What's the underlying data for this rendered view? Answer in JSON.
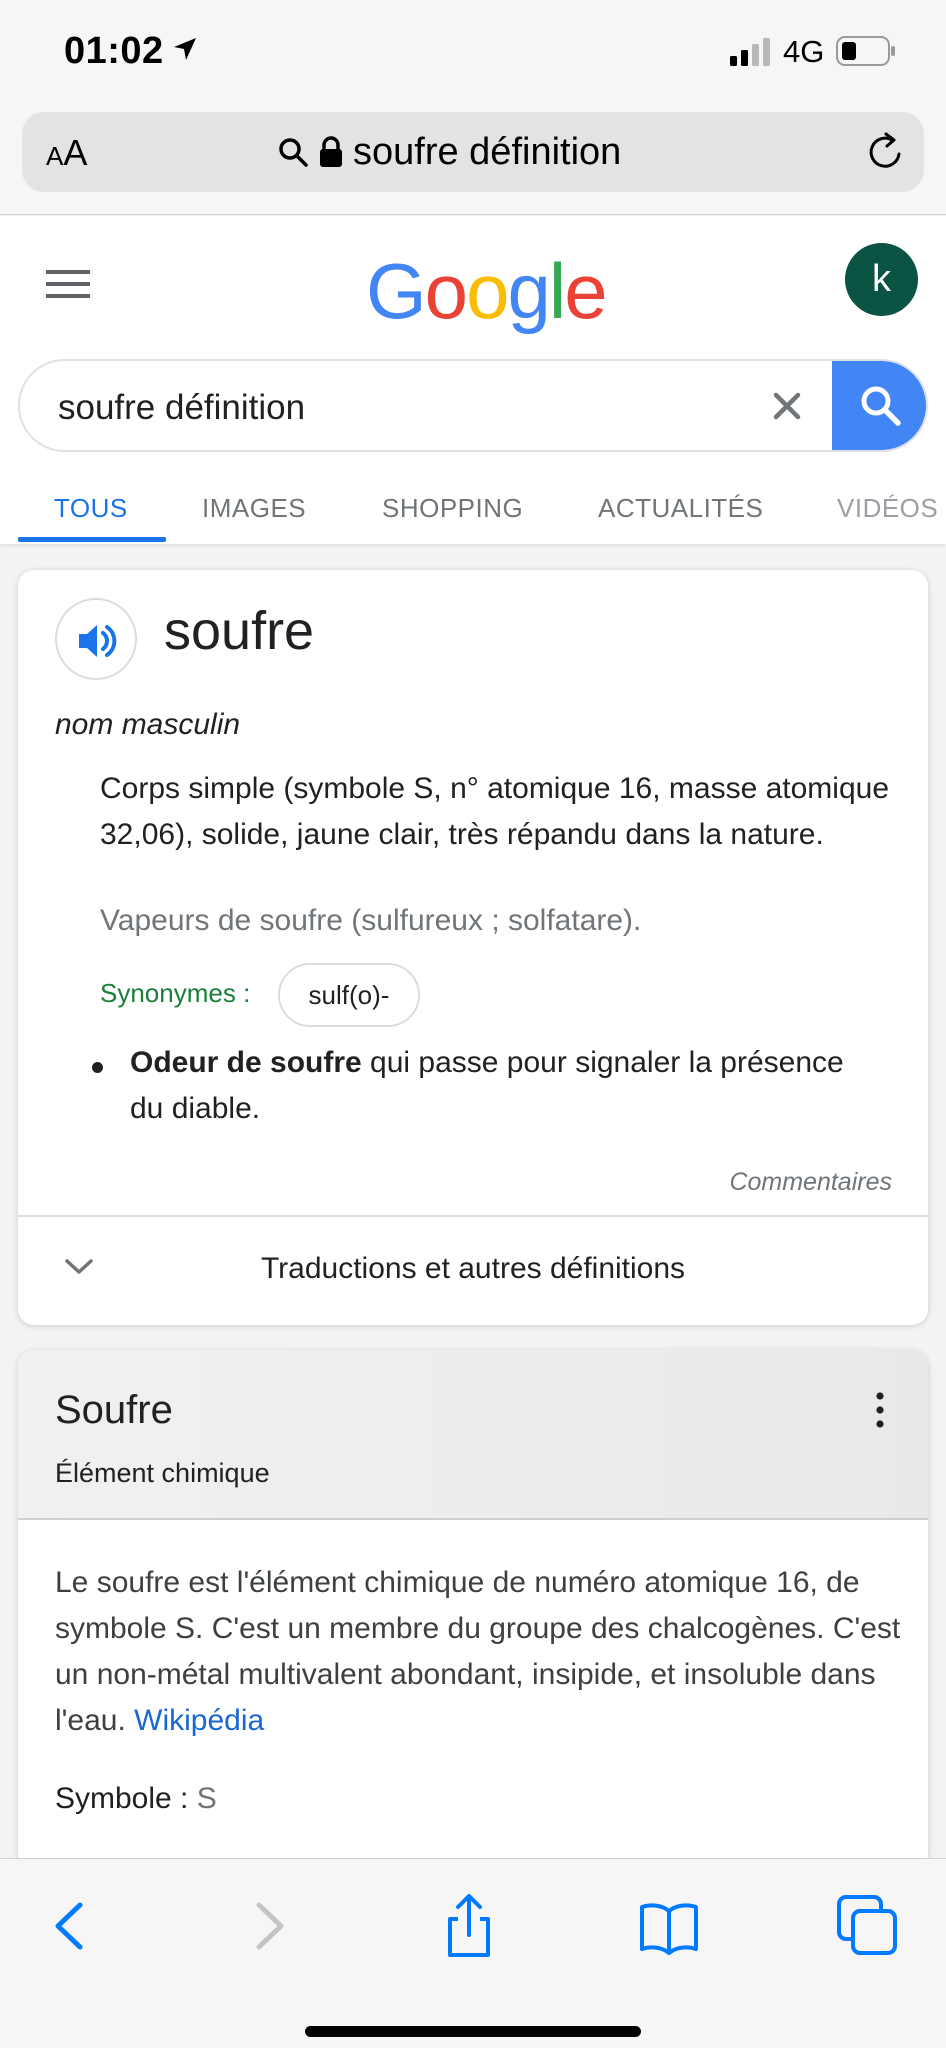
{
  "status": {
    "time": "01:02",
    "network": "4G"
  },
  "address": {
    "aa_small": "A",
    "aa_large": "A",
    "url": "soufre définition"
  },
  "header": {
    "avatar_letter": "k"
  },
  "search": {
    "query": "soufre définition"
  },
  "tabs": [
    {
      "label": "TOUS"
    },
    {
      "label": "IMAGES"
    },
    {
      "label": "SHOPPING"
    },
    {
      "label": "ACTUALITÉS"
    },
    {
      "label": "VIDÉOS"
    }
  ],
  "dictionary": {
    "word": "soufre",
    "part_of_speech": "nom masculin",
    "definition": "Corps simple (symbole S, n° atomique 16, masse atomique 32,06), solide, jaune clair, très répandu dans la nature.",
    "example": "Vapeurs de soufre (sulfureux ; solfatare).",
    "synonyms_label": "Synonymes :",
    "synonym": "sulf(o)-",
    "bullet_bold": "Odeur de soufre",
    "bullet_rest": " qui passe pour signaler la présence du diable.",
    "comments": "Commentaires",
    "translations": "Traductions et autres définitions"
  },
  "knowledge": {
    "title": "Soufre",
    "subtitle": "Élément chimique",
    "description": "Le soufre est l'élément chimique de numéro atomique 16, de symbole S. C'est un membre du groupe des chalcogènes. C'est un non-métal multivalent abondant, insipide, et insoluble dans l'eau. ",
    "source_link": "Wikipédia",
    "fact_label": "Symbole : ",
    "fact_value": "S"
  },
  "colors": {
    "google_blue": "#4285f4",
    "google_red": "#ea4335",
    "google_yellow": "#fbbc05",
    "google_green": "#34a853",
    "active_tab": "#1a73e8",
    "avatar": "#0b5443",
    "ios_blue": "#007aff"
  }
}
